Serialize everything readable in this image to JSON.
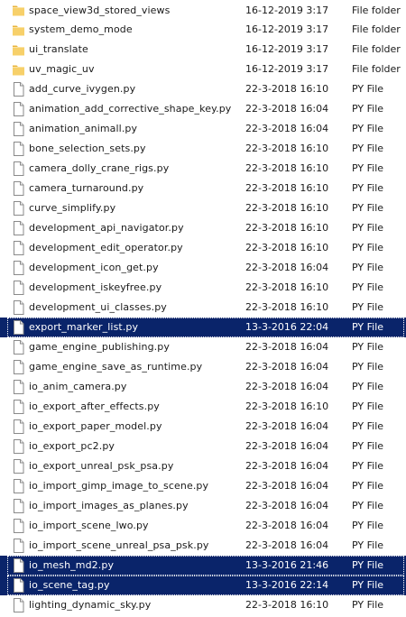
{
  "colors": {
    "selection_bg": "#0a246a",
    "folder_icon": "#f2c649",
    "text": "#1a1a1a"
  },
  "rows": [
    {
      "name": "space_view3d_stored_views",
      "date": "16-12-2019 3:17",
      "type": "File folder",
      "icon": "folder-icon",
      "selected": false
    },
    {
      "name": "system_demo_mode",
      "date": "16-12-2019 3:17",
      "type": "File folder",
      "icon": "folder-icon",
      "selected": false
    },
    {
      "name": "ui_translate",
      "date": "16-12-2019 3:17",
      "type": "File folder",
      "icon": "folder-icon",
      "selected": false
    },
    {
      "name": "uv_magic_uv",
      "date": "16-12-2019 3:17",
      "type": "File folder",
      "icon": "folder-icon",
      "selected": false
    },
    {
      "name": "add_curve_ivygen.py",
      "date": "22-3-2018 16:10",
      "type": "PY File",
      "icon": "file-icon",
      "selected": false
    },
    {
      "name": "animation_add_corrective_shape_key.py",
      "date": "22-3-2018 16:04",
      "type": "PY File",
      "icon": "file-icon",
      "selected": false
    },
    {
      "name": "animation_animall.py",
      "date": "22-3-2018 16:04",
      "type": "PY File",
      "icon": "file-icon",
      "selected": false
    },
    {
      "name": "bone_selection_sets.py",
      "date": "22-3-2018 16:10",
      "type": "PY File",
      "icon": "file-icon",
      "selected": false
    },
    {
      "name": "camera_dolly_crane_rigs.py",
      "date": "22-3-2018 16:10",
      "type": "PY File",
      "icon": "file-icon",
      "selected": false
    },
    {
      "name": "camera_turnaround.py",
      "date": "22-3-2018 16:10",
      "type": "PY File",
      "icon": "file-icon",
      "selected": false
    },
    {
      "name": "curve_simplify.py",
      "date": "22-3-2018 16:10",
      "type": "PY File",
      "icon": "file-icon",
      "selected": false
    },
    {
      "name": "development_api_navigator.py",
      "date": "22-3-2018 16:10",
      "type": "PY File",
      "icon": "file-icon",
      "selected": false
    },
    {
      "name": "development_edit_operator.py",
      "date": "22-3-2018 16:10",
      "type": "PY File",
      "icon": "file-icon",
      "selected": false
    },
    {
      "name": "development_icon_get.py",
      "date": "22-3-2018 16:04",
      "type": "PY File",
      "icon": "file-icon",
      "selected": false
    },
    {
      "name": "development_iskeyfree.py",
      "date": "22-3-2018 16:10",
      "type": "PY File",
      "icon": "file-icon",
      "selected": false
    },
    {
      "name": "development_ui_classes.py",
      "date": "22-3-2018 16:10",
      "type": "PY File",
      "icon": "file-icon",
      "selected": false
    },
    {
      "name": "export_marker_list.py",
      "date": "13-3-2016 22:04",
      "type": "PY File",
      "icon": "file-icon",
      "selected": true
    },
    {
      "name": "game_engine_publishing.py",
      "date": "22-3-2018 16:04",
      "type": "PY File",
      "icon": "file-icon",
      "selected": false
    },
    {
      "name": "game_engine_save_as_runtime.py",
      "date": "22-3-2018 16:04",
      "type": "PY File",
      "icon": "file-icon",
      "selected": false
    },
    {
      "name": "io_anim_camera.py",
      "date": "22-3-2018 16:04",
      "type": "PY File",
      "icon": "file-icon",
      "selected": false
    },
    {
      "name": "io_export_after_effects.py",
      "date": "22-3-2018 16:10",
      "type": "PY File",
      "icon": "file-icon",
      "selected": false
    },
    {
      "name": "io_export_paper_model.py",
      "date": "22-3-2018 16:04",
      "type": "PY File",
      "icon": "file-icon",
      "selected": false
    },
    {
      "name": "io_export_pc2.py",
      "date": "22-3-2018 16:04",
      "type": "PY File",
      "icon": "file-icon",
      "selected": false
    },
    {
      "name": "io_export_unreal_psk_psa.py",
      "date": "22-3-2018 16:04",
      "type": "PY File",
      "icon": "file-icon",
      "selected": false
    },
    {
      "name": "io_import_gimp_image_to_scene.py",
      "date": "22-3-2018 16:04",
      "type": "PY File",
      "icon": "file-icon",
      "selected": false
    },
    {
      "name": "io_import_images_as_planes.py",
      "date": "22-3-2018 16:04",
      "type": "PY File",
      "icon": "file-icon",
      "selected": false
    },
    {
      "name": "io_import_scene_lwo.py",
      "date": "22-3-2018 16:04",
      "type": "PY File",
      "icon": "file-icon",
      "selected": false
    },
    {
      "name": "io_import_scene_unreal_psa_psk.py",
      "date": "22-3-2018 16:04",
      "type": "PY File",
      "icon": "file-icon",
      "selected": false
    },
    {
      "name": "io_mesh_md2.py",
      "date": "13-3-2016 21:46",
      "type": "PY File",
      "icon": "file-icon",
      "selected": true
    },
    {
      "name": "io_scene_tag.py",
      "date": "13-3-2016 22:14",
      "type": "PY File",
      "icon": "file-icon",
      "selected": true
    },
    {
      "name": "lighting_dynamic_sky.py",
      "date": "22-3-2018 16:10",
      "type": "PY File",
      "icon": "file-icon",
      "selected": false
    }
  ]
}
